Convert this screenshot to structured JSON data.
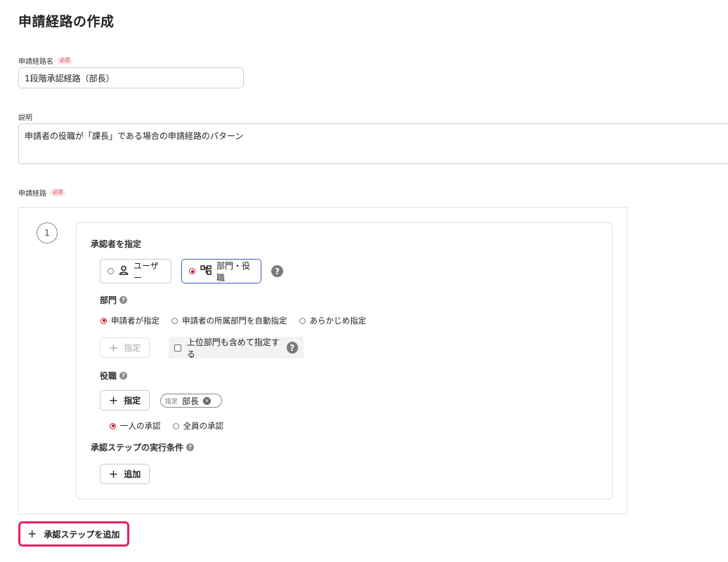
{
  "page": {
    "title": "申請経路の作成"
  },
  "required_badge": "必須",
  "route_name": {
    "label": "申請経路名",
    "value": "1段階承認経路（部長）"
  },
  "description": {
    "label": "説明",
    "value": "申請者の役職が「課長」である場合の申請経路のパターン"
  },
  "route": {
    "label": "申請経路"
  },
  "step": {
    "number": "1",
    "approver_heading": "承認者を指定",
    "approver_options": [
      {
        "label": "ユーザー",
        "selected": false,
        "icon": "user-icon"
      },
      {
        "label": "部門・役職",
        "selected": true,
        "icon": "org-chart-icon"
      }
    ],
    "department": {
      "heading": "部門",
      "options": [
        {
          "label": "申請者が指定",
          "selected": true
        },
        {
          "label": "申請者の所属部門を自動指定",
          "selected": false
        },
        {
          "label": "あらかじめ指定",
          "selected": false
        }
      ],
      "specify_button": "指定",
      "include_parent_label": "上位部門も含めて指定する"
    },
    "position": {
      "heading": "役職",
      "specify_button": "指定",
      "chip_tag": "指定",
      "chip_label": "部長",
      "options": [
        {
          "label": "一人の承認",
          "selected": true
        },
        {
          "label": "全員の承認",
          "selected": false
        }
      ]
    },
    "condition": {
      "heading": "承認ステップの実行条件",
      "add_button": "追加"
    }
  },
  "add_step_button": "承認ステップを追加",
  "colors": {
    "accent_red": "#c7172c",
    "selected_border": "#3d5fa8",
    "highlight_pink": "#e91e63"
  }
}
